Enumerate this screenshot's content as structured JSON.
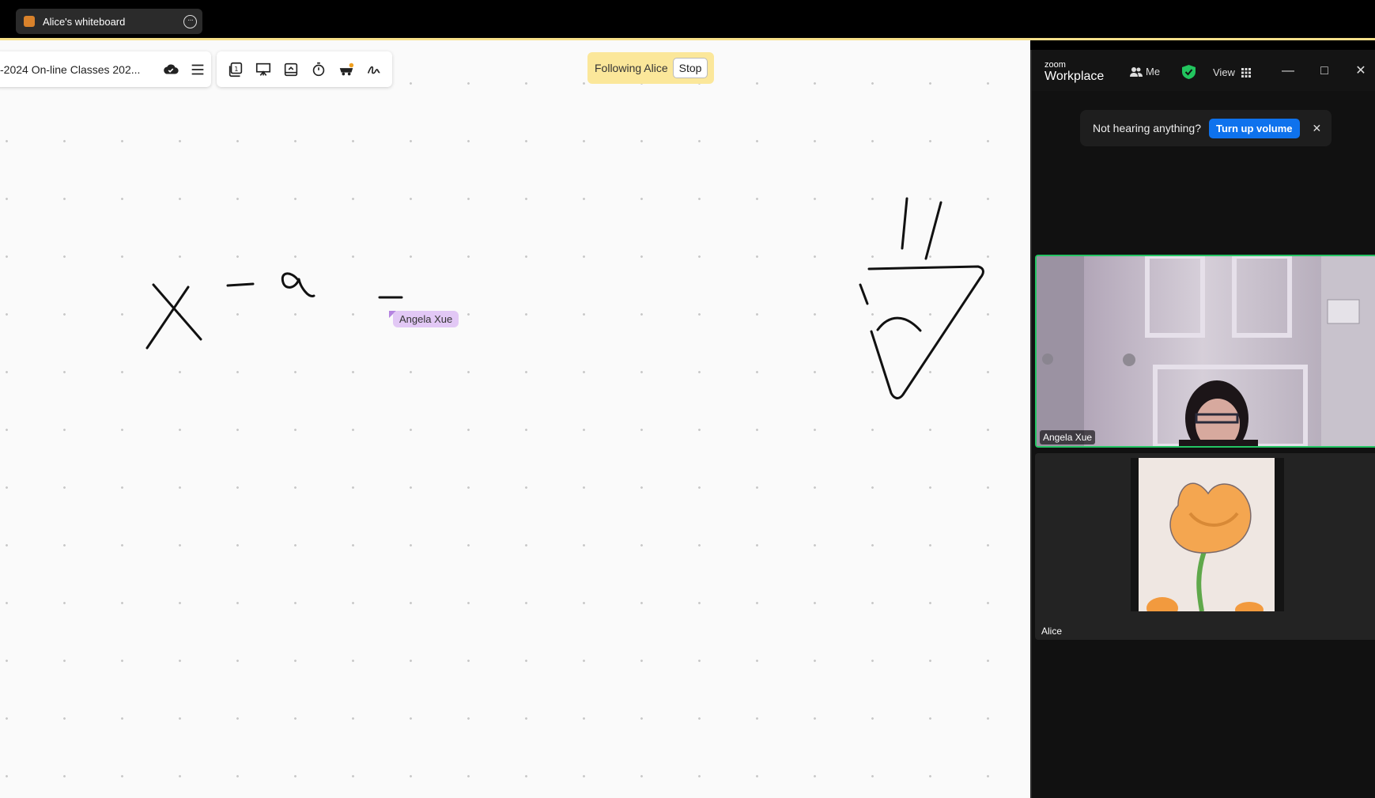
{
  "share_tab": {
    "title": "Alice's whiteboard"
  },
  "whiteboard": {
    "doc_title": "-2024 On-line Classes 202...",
    "following_text": "Following Alice",
    "stop_label": "Stop",
    "cursor_user": "Angela Xue",
    "toolbar_icons": [
      "cloud-sync-icon",
      "menu-icon",
      "pages-icon",
      "present-icon",
      "board-icon",
      "timer-icon",
      "collaborators-icon",
      "signature-icon"
    ]
  },
  "zoom": {
    "logo_small": "zoom",
    "logo_big": "Workplace",
    "me_label": "Me",
    "view_label": "View",
    "notification_text": "Not hearing anything?",
    "notification_button": "Turn up volume",
    "participants": [
      {
        "name": "Angela Xue",
        "speaking": true
      },
      {
        "name": "Alice",
        "speaking": false
      }
    ]
  },
  "colors": {
    "accent": "#0e72ed",
    "speaking_border": "#24c463",
    "follow_bg": "#fbe79a",
    "cursor_label_bg": "#e2c8f5"
  }
}
